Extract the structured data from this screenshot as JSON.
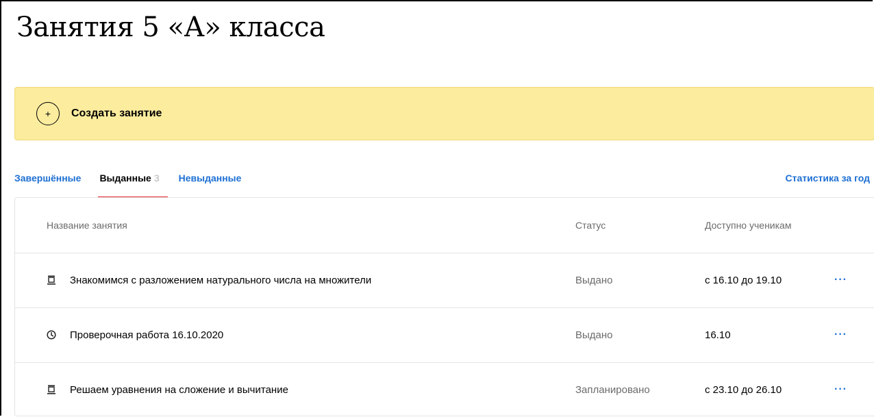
{
  "page": {
    "title": "Занятия 5 «А» класса"
  },
  "create": {
    "icon": "plus-circle-icon",
    "label": "Создать занятие"
  },
  "tabs": [
    {
      "label": "Завершённые",
      "active": false
    },
    {
      "label": "Выданные",
      "count": "3",
      "active": true
    },
    {
      "label": "Невыданные",
      "active": false
    }
  ],
  "stats_link": "Статистика за год",
  "table": {
    "columns": {
      "name": "Название занятия",
      "status": "Статус",
      "available": "Доступно ученикам"
    },
    "rows": [
      {
        "icon": "lesson-document-icon",
        "title": "Знакомимся с разложением натурального числа на множители",
        "status": "Выдано",
        "available": "с 16.10 до 19.10",
        "more": "···"
      },
      {
        "icon": "clock-icon",
        "title": "Проверочная работа 16.10.2020",
        "status": "Выдано",
        "available": "16.10",
        "more": "···"
      },
      {
        "icon": "lesson-document-icon",
        "title": "Решаем уравнения на сложение и вычитание",
        "status": "Запланировано",
        "available": "с 23.10 до 26.10",
        "more": "···"
      }
    ]
  },
  "colors": {
    "banner_bg": "#fcec9e",
    "link": "#1d6fd3",
    "active_tab_underline": "#e0202a"
  }
}
